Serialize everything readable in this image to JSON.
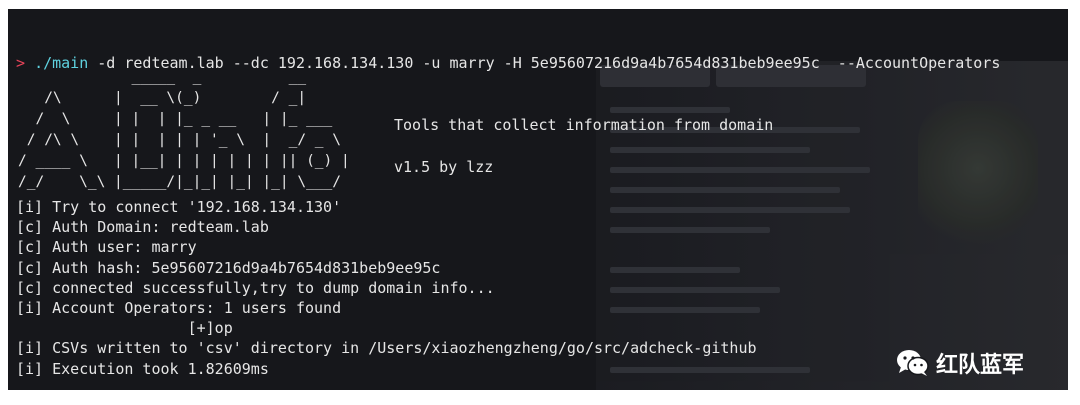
{
  "terminal": {
    "prompt_symbol": ">",
    "command": "./main",
    "arguments": " -d redteam.lab --dc 192.168.134.130 -u marry -H 5e95607216d9a4b7654d831beb9ee95c  --AccountOperators"
  },
  "banner": {
    "ascii_art": "             _____  _          __\n   /\\      |  __ \\(_)        / _|\n  /  \\     | |  | |_ _ __   | |_ ___\n / /\\ \\    | |  | | | '_ \\  |  _/ _ \\\n/ ____ \\   | |__| | | | | | | || (_) |\n/_/    \\_\\ |_____/|_|_| |_| |_| \\___/",
    "tagline": "Tools that collect information from domain",
    "version": "v1.5 by lzz"
  },
  "output": {
    "lines": [
      "[i] Try to connect '192.168.134.130'",
      "[c] Auth Domain: redteam.lab",
      "[c] Auth user: marry",
      "[c] Auth hash: 5e95607216d9a4b7654d831beb9ee95c",
      "[c] connected successfully,try to dump domain info...",
      "[i] Account Operators: 1 users found",
      "                   [+]op",
      "[i] CSVs written to 'csv' directory in /Users/xiaozhengzheng/go/src/adcheck-github",
      "[i] Execution took 1.82609ms"
    ]
  },
  "watermark": {
    "icon": "wechat-icon",
    "text": "红队蓝军"
  },
  "colors": {
    "background": "#16171b",
    "prompt": "#e8445a",
    "command": "#5fd2e0",
    "text": "#e6e6e6"
  }
}
